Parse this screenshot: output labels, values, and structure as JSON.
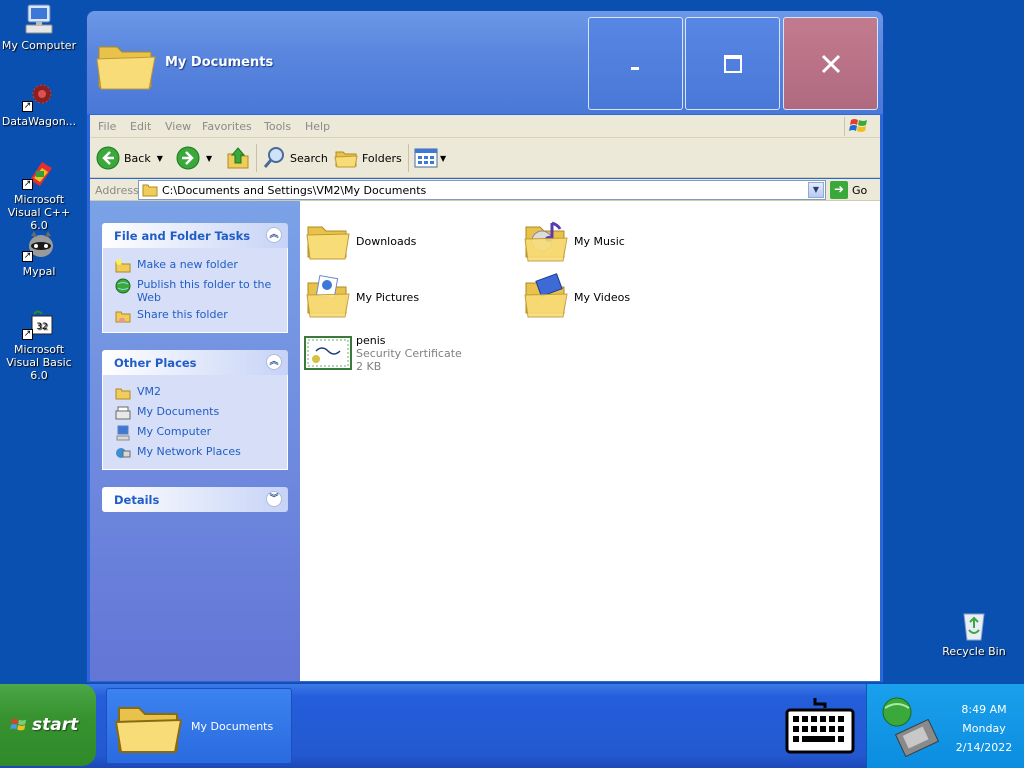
{
  "desktop": {
    "icons": [
      {
        "label": "My Computer"
      },
      {
        "label": "DataWagon..."
      },
      {
        "label": "Microsoft Visual C++ 6.0"
      },
      {
        "label": "Mypal"
      },
      {
        "label": "Microsoft Visual Basic 6.0"
      }
    ],
    "recycle_bin": "Recycle Bin"
  },
  "window": {
    "title": "My Documents",
    "buttons": {
      "minimize": "minimize",
      "maximize": "maximize",
      "close": "close"
    },
    "menu": [
      "File",
      "Edit",
      "View",
      "Favorites",
      "Tools",
      "Help"
    ],
    "toolbar": {
      "back": "Back",
      "search": "Search",
      "folders": "Folders"
    },
    "address": {
      "label": "Address",
      "value": "C:\\Documents and Settings\\VM2\\My Documents",
      "go": "Go"
    },
    "task_pane": {
      "file_tasks": {
        "title": "File and Folder Tasks",
        "links": [
          "Make a new folder",
          "Publish this folder to the Web",
          "Share this folder"
        ]
      },
      "other_places": {
        "title": "Other Places",
        "links": [
          "VM2",
          "My Documents",
          "My Computer",
          "My Network Places"
        ]
      },
      "details": {
        "title": "Details"
      }
    },
    "items": [
      {
        "name": "Downloads",
        "icon": "folder-icon"
      },
      {
        "name": "My Music",
        "icon": "music-folder-icon"
      },
      {
        "name": "My Pictures",
        "icon": "pictures-folder-icon"
      },
      {
        "name": "My Videos",
        "icon": "videos-folder-icon"
      }
    ],
    "file": {
      "name": "penis",
      "type": "Security Certificate",
      "size": "2 KB"
    }
  },
  "taskbar": {
    "start": "start",
    "task_label": "My Documents",
    "clock": {
      "time": "8:49 AM",
      "day": "Monday",
      "date": "2/14/2022"
    }
  },
  "colors": {
    "desktop": "#0a50b0",
    "title_bar": "#5a86de",
    "close_button": "#b06a80",
    "task_pane": "#6e8ce0",
    "link": "#215dc6",
    "start_button": "#37922f",
    "tray": "#0c8de0"
  }
}
